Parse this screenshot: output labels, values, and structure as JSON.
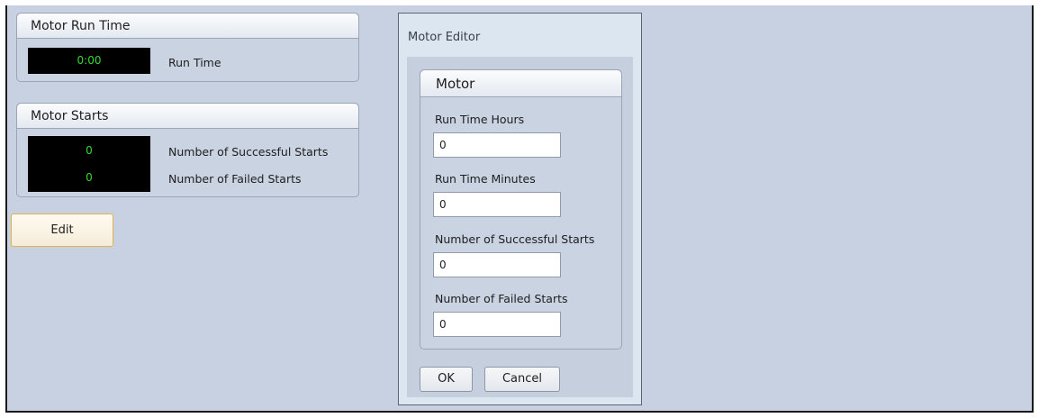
{
  "run_time_group": {
    "title": "Motor Run Time",
    "display_value": "0:00",
    "label": "Run Time"
  },
  "starts_group": {
    "title": "Motor Starts",
    "successful_value": "0",
    "successful_label": "Number of Successful Starts",
    "failed_value": "0",
    "failed_label": "Number of Failed Starts"
  },
  "edit_button": "Edit",
  "dialog": {
    "title": "Motor Editor",
    "group_title": "Motor",
    "fields": [
      {
        "label": "Run Time Hours",
        "value": "0"
      },
      {
        "label": "Run Time Minutes",
        "value": "0"
      },
      {
        "label": "Number of Successful Starts",
        "value": "0"
      },
      {
        "label": "Number of Failed Starts",
        "value": "0"
      }
    ],
    "ok_label": "OK",
    "cancel_label": "Cancel"
  },
  "colors": {
    "background": "#c7d1e1",
    "display_text": "#38d838",
    "edit_border": "#e2b24f"
  }
}
